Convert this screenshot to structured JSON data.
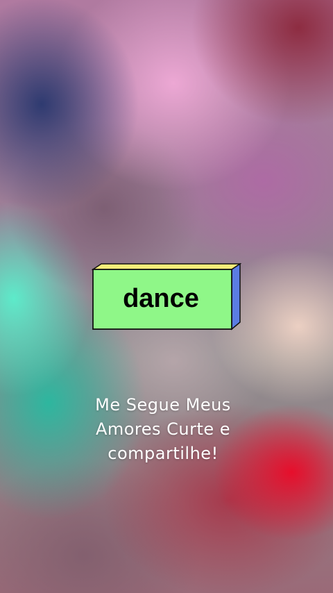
{
  "sticker": {
    "label": "dance",
    "colors": {
      "front": "#8ff788",
      "top": "#f8ee7a",
      "side": "#5b7de3",
      "outline": "#111111"
    }
  },
  "caption": {
    "line1": "Me Segue Meus",
    "line2": "Amores Curte e",
    "line3": "compartilhe!"
  }
}
